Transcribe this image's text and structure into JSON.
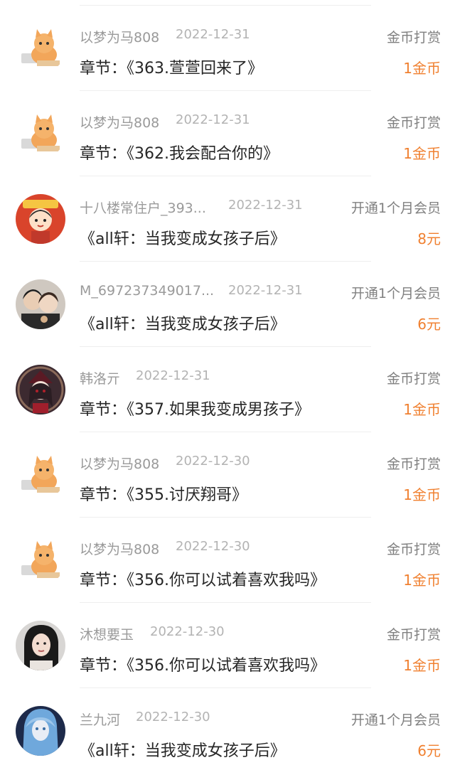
{
  "records": [
    {
      "name": "以梦为马808",
      "date": "2022-12-31",
      "title": "章节：《363.萱萱回来了》",
      "type": "金币打赏",
      "amount": "1金币",
      "avatar": "cat-avatar"
    },
    {
      "name": "以梦为马808",
      "date": "2022-12-31",
      "title": "章节：《362.我会配合你的》",
      "type": "金币打赏",
      "amount": "1金币",
      "avatar": "cat-avatar"
    },
    {
      "name": "十八楼常住户_393...",
      "date": "2022-12-31",
      "title": "《all轩：当我变成女孩子后》",
      "type": "开通1个月会员",
      "amount": "8元",
      "avatar": "cartoon-avatar"
    },
    {
      "name": "M_697237349017...",
      "date": "2022-12-31",
      "title": "《all轩：当我变成女孩子后》",
      "type": "开通1个月会员",
      "amount": "6元",
      "avatar": "couple-photo-avatar"
    },
    {
      "name": "韩洛亓",
      "date": "2022-12-31",
      "title": "章节：《357.如果我变成男孩子》",
      "type": "金币打赏",
      "amount": "1金币",
      "avatar": "anime-girl-avatar"
    },
    {
      "name": "以梦为马808",
      "date": "2022-12-30",
      "title": "章节：《355.讨厌翔哥》",
      "type": "金币打赏",
      "amount": "1金币",
      "avatar": "cat-avatar"
    },
    {
      "name": "以梦为马808",
      "date": "2022-12-30",
      "title": "章节：《356.你可以试着喜欢我吗》",
      "type": "金币打赏",
      "amount": "1金币",
      "avatar": "cat-avatar"
    },
    {
      "name": "沐想要玉",
      "date": "2022-12-30",
      "title": "章节：《356.你可以试着喜欢我吗》",
      "type": "金币打赏",
      "amount": "1金币",
      "avatar": "girl-photo-avatar"
    },
    {
      "name": "兰九河",
      "date": "2022-12-30",
      "title": "《all轩：当我变成女孩子后》",
      "type": "开通1个月会员",
      "amount": "6元",
      "avatar": "blue-hair-avatar"
    }
  ],
  "colors": {
    "amount": "#f08030",
    "name": "#9a9a9a",
    "date": "#b3b3b3",
    "title": "#262626",
    "type": "#808080"
  }
}
